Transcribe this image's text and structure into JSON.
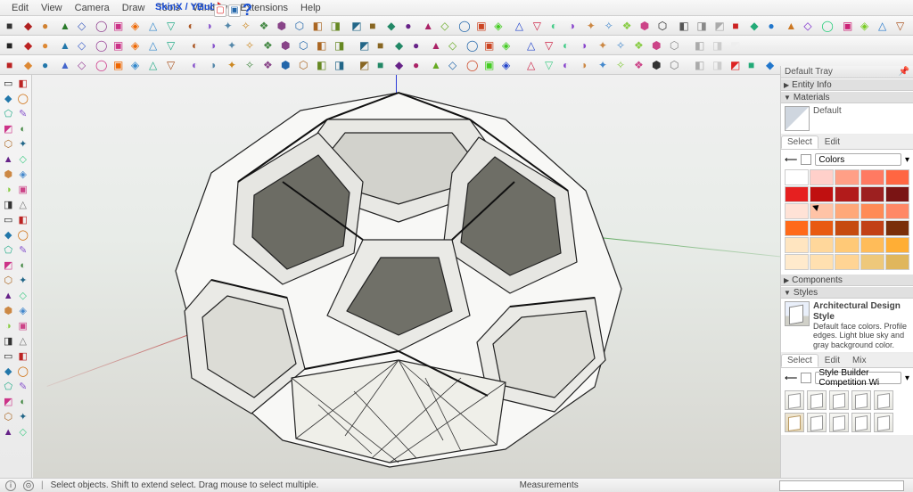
{
  "menu": [
    "Edit",
    "View",
    "Camera",
    "Draw",
    "Tools",
    "Window",
    "Extensions",
    "Help"
  ],
  "skinx": "SkinX / YBub",
  "tray": {
    "title": "Default Tray",
    "sections": {
      "entity": "Entity Info",
      "materials": "Materials",
      "components": "Components",
      "styles": "Styles"
    }
  },
  "materials": {
    "name": "Default",
    "tabs": [
      "Select",
      "Edit"
    ],
    "palette_dropdown": "Colors",
    "swatches": [
      "#ffffff",
      "#ffd0ca",
      "#ff9f86",
      "#ff7a62",
      "#ff6642",
      "#e62020",
      "#c01010",
      "#b21b1b",
      "#9d2020",
      "#7a1414",
      "#ffe2d6",
      "#ffc3a6",
      "#ffa879",
      "#ff8b56",
      "#ff8866",
      "#ff6a1a",
      "#e85a12",
      "#c64a0f",
      "#c24016",
      "#7a2e0a",
      "#ffe5c0",
      "#ffd79b",
      "#ffc977",
      "#ffbc59",
      "#ffae35",
      "#ffeacc",
      "#ffe0b0",
      "#ffd494",
      "#eec87a",
      "#e0b65c"
    ]
  },
  "styles": {
    "title": "Architectural Design Style",
    "desc": "Default face colors. Profile edges. Light blue sky and gray background color.",
    "tabs": [
      "Select",
      "Edit",
      "Mix"
    ],
    "dropdown": "Style Builder Competition Wi"
  },
  "status": {
    "hint": "Select objects. Shift to extend select. Drag mouse to select multiple.",
    "measurements_label": "Measurements"
  }
}
